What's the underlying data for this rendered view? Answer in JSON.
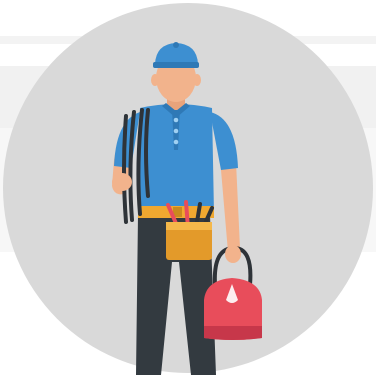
{
  "illustration": {
    "subject": "electrician-worker",
    "colors": {
      "circle": "#d9d9d9",
      "cap": "#3d8fd1",
      "shirt": "#3d8fd1",
      "skin": "#f2b38c",
      "pants": "#333a40",
      "belt": "#f0a830",
      "bag": "#e84d5b",
      "wire": "#2e3338"
    },
    "icons": [
      "cap-icon",
      "wire-coil-icon",
      "tool-belt-icon",
      "tool-bag-icon"
    ]
  }
}
